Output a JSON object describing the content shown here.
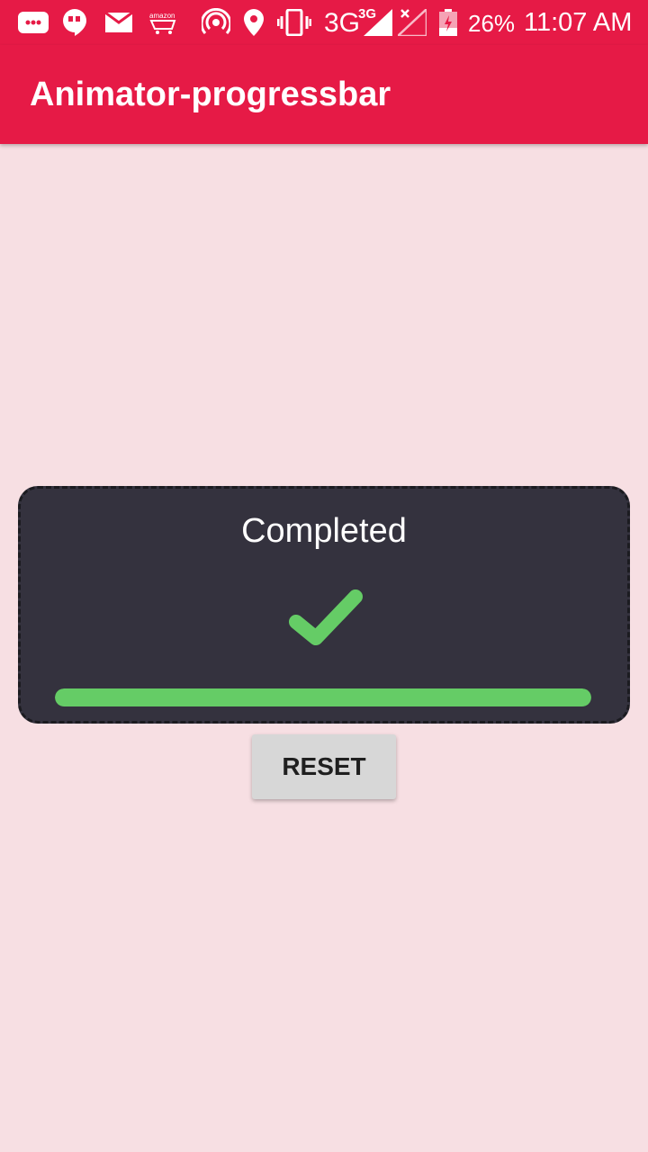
{
  "status_bar": {
    "notification_icons": [
      "messaging-icon",
      "hangouts-icon",
      "gmail-icon",
      "amazon-shopping-icon",
      "hotspot-icon",
      "location-icon",
      "vibrate-icon"
    ],
    "network_type": "3G",
    "network_badge": "3G",
    "battery_percent": "26%",
    "time": "11:07 AM"
  },
  "app_bar": {
    "title": "Animator-progressbar"
  },
  "progress_card": {
    "status_text": "Completed",
    "status_icon": "check-icon",
    "progress": 1.0,
    "progress_color": "#65cc66"
  },
  "reset_button": {
    "label": "RESET"
  },
  "colors": {
    "primary": "#e61a46",
    "background": "#f7dfe3",
    "card": "#34323e",
    "accent_green": "#65cc66"
  }
}
